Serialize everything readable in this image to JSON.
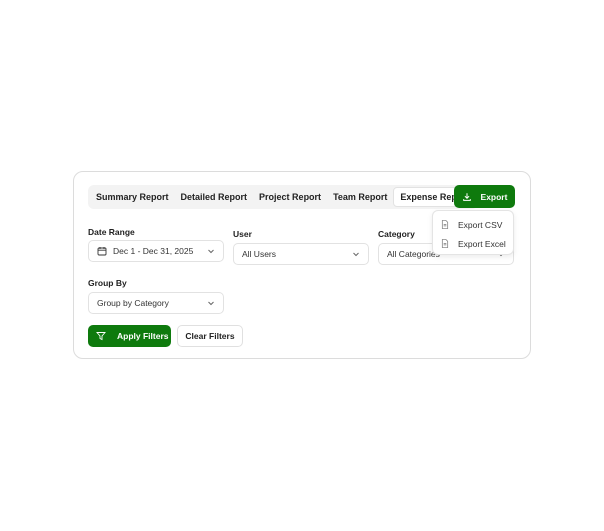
{
  "tabs": [
    {
      "label": "Summary Report",
      "active": false
    },
    {
      "label": "Detailed Report",
      "active": false
    },
    {
      "label": "Project Report",
      "active": false
    },
    {
      "label": "Team Report",
      "active": false
    },
    {
      "label": "Expense Report",
      "active": true
    }
  ],
  "export": {
    "label": "Export",
    "menu": [
      {
        "label": "Export CSV",
        "icon": "file-icon"
      },
      {
        "label": "Export Excel",
        "icon": "file-icon"
      }
    ]
  },
  "filters": {
    "date_range": {
      "label": "Date Range",
      "value": "Dec 1 - Dec 31, 2025",
      "icon": "calendar-icon"
    },
    "user": {
      "label": "User",
      "value": "All Users"
    },
    "category": {
      "label": "Category",
      "value": "All Categories"
    },
    "group_by": {
      "label": "Group By",
      "value": "Group by Category"
    }
  },
  "actions": {
    "apply_label": "Apply Filters",
    "clear_label": "Clear Filters"
  },
  "colors": {
    "primary": "#0e7a0d",
    "border": "#dcdcdc"
  }
}
